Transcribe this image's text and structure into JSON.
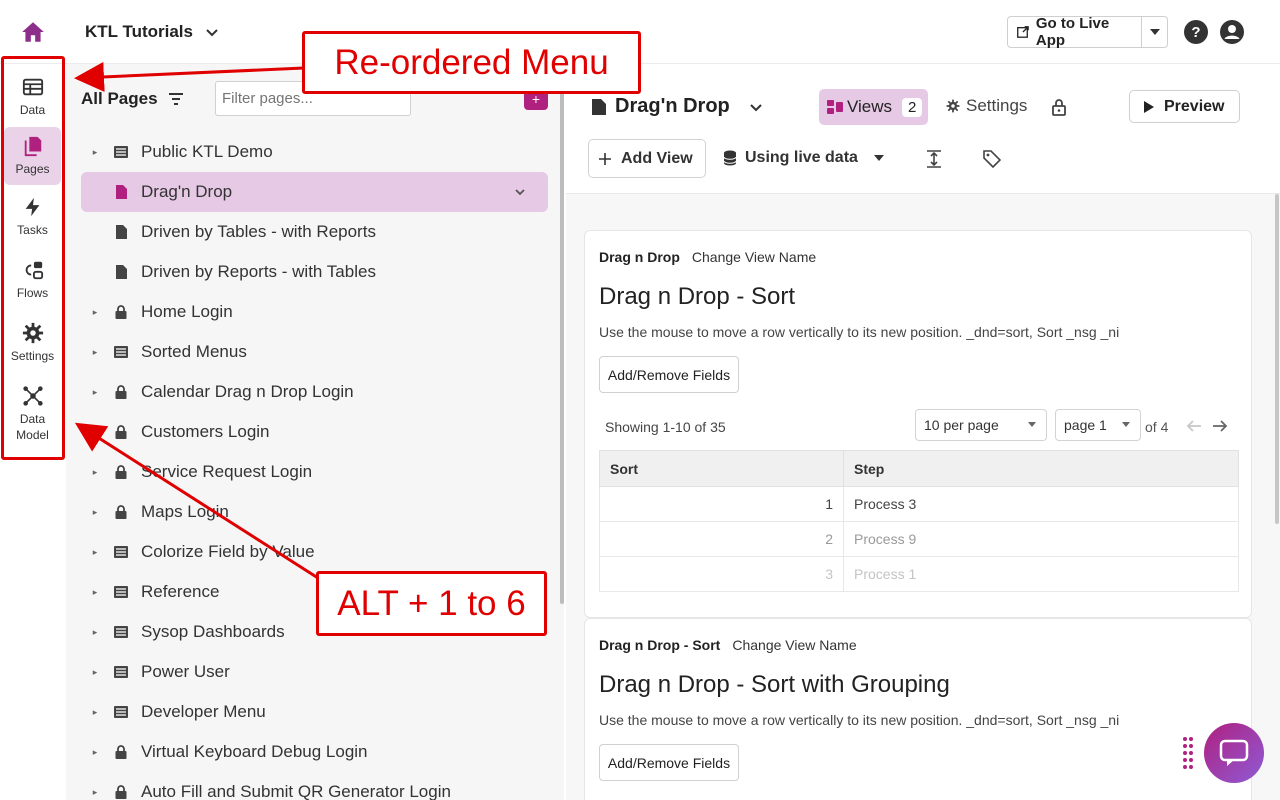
{
  "topbar": {
    "app_name": "KTL Tutorials",
    "live_app_label": "Go to Live App"
  },
  "rail": {
    "items": [
      {
        "label": "Data"
      },
      {
        "label": "Pages"
      },
      {
        "label": "Tasks"
      },
      {
        "label": "Flows"
      },
      {
        "label": "Settings"
      },
      {
        "label": "Data Model"
      }
    ]
  },
  "pages_panel": {
    "title": "All Pages",
    "filter_placeholder": "Filter pages...",
    "add_label": "+",
    "rows": [
      {
        "label": "Public KTL Demo",
        "icon": "menu-icon",
        "caret": true
      },
      {
        "label": "Drag'n Drop",
        "icon": "page-icon",
        "caret": false,
        "active": true
      },
      {
        "label": "Driven by Tables - with Reports",
        "icon": "page-icon",
        "caret": false
      },
      {
        "label": "Driven by Reports - with Tables",
        "icon": "page-icon",
        "caret": false
      },
      {
        "label": "Home Login",
        "icon": "lock-icon",
        "caret": true
      },
      {
        "label": "Sorted Menus",
        "icon": "menu-icon",
        "caret": true
      },
      {
        "label": "Calendar Drag n Drop Login",
        "icon": "lock-icon",
        "caret": true
      },
      {
        "label": "Customers Login",
        "icon": "lock-icon",
        "caret": true
      },
      {
        "label": "Service Request Login",
        "icon": "lock-icon",
        "caret": true
      },
      {
        "label": "Maps Login",
        "icon": "lock-icon",
        "caret": true
      },
      {
        "label": "Colorize Field by Value",
        "icon": "menu-icon",
        "caret": true
      },
      {
        "label": "Reference",
        "icon": "menu-icon",
        "caret": true
      },
      {
        "label": "Sysop Dashboards",
        "icon": "menu-icon",
        "caret": true
      },
      {
        "label": "Power User",
        "icon": "menu-icon",
        "caret": true
      },
      {
        "label": "Developer Menu",
        "icon": "menu-icon",
        "caret": true
      },
      {
        "label": "Virtual Keyboard Debug Login",
        "icon": "lock-icon",
        "caret": true
      },
      {
        "label": "Auto Fill and Submit QR Generator Login",
        "icon": "lock-icon",
        "caret": true
      }
    ]
  },
  "main": {
    "page_title": "Drag'n Drop",
    "views_label": "Views",
    "views_count": "2",
    "settings_label": "Settings",
    "preview_label": "Preview",
    "add_view_label": "Add View",
    "live_data_label": "Using live data"
  },
  "card1": {
    "view_name": "Drag n Drop",
    "change_label": "Change View Name",
    "title": "Drag n Drop - Sort",
    "desc": "Use the mouse to move a row vertically to its new position. _dnd=sort, Sort _nsg _ni",
    "fields_label": "Add/Remove Fields",
    "showing": "Showing 1-10 of 35",
    "per_page": "10 per page",
    "page": "page 1",
    "of": "of 4",
    "columns": [
      "Sort",
      "Step"
    ],
    "rows": [
      {
        "sort": "1",
        "step": "Process 3"
      },
      {
        "sort": "2",
        "step": "Process 9"
      },
      {
        "sort": "3",
        "step": "Process 1"
      }
    ]
  },
  "card2": {
    "view_name": "Drag n Drop - Sort",
    "change_label": "Change View Name",
    "title": "Drag n Drop - Sort with Grouping",
    "desc": "Use the mouse to move a row vertically to its new position. _dnd=sort, Sort _nsg _ni",
    "fields_label": "Add/Remove Fields"
  },
  "annotations": {
    "menu_callout": "Re-ordered Menu",
    "alt_callout": "ALT + 1 to 6"
  },
  "colors": {
    "accent": "#b0207f",
    "active_bg": "#e6c9e4",
    "annotation": "#e00000"
  }
}
